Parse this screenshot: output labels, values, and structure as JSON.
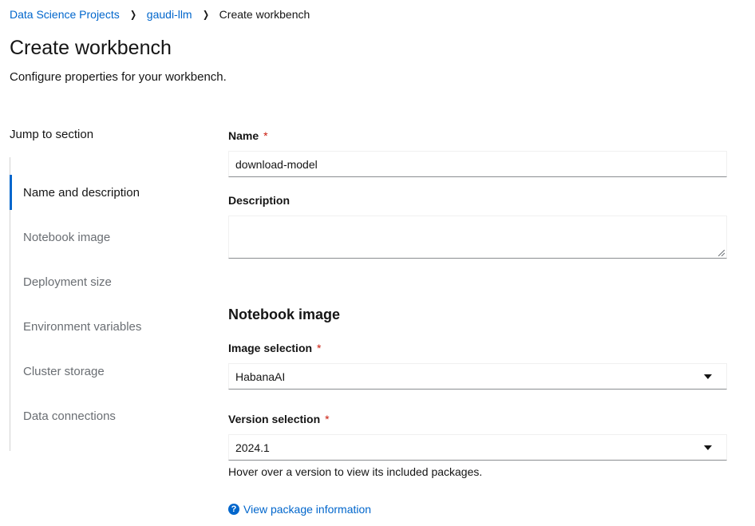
{
  "breadcrumb": {
    "items": [
      "Data Science Projects",
      "gaudi-llm"
    ],
    "current": "Create workbench"
  },
  "page": {
    "title": "Create workbench",
    "description": "Configure properties for your workbench."
  },
  "jump": {
    "title": "Jump to section",
    "items": [
      "Name and description",
      "Notebook image",
      "Deployment size",
      "Environment variables",
      "Cluster storage",
      "Data connections"
    ],
    "active": "Name and description"
  },
  "form": {
    "name_label": "Name",
    "name_value": "download-model",
    "description_label": "Description",
    "description_value": "",
    "notebook_section": "Notebook image",
    "image_label": "Image selection",
    "image_value": "HabanaAI",
    "version_label": "Version selection",
    "version_value": "2024.1",
    "version_helper": "Hover over a version to view its included packages.",
    "package_link": "View package information",
    "required_mark": "*"
  },
  "icons": {
    "breadcrumb_separator": "chevron-right-icon",
    "select_caret": "caret-down-icon",
    "help": "question-circle-icon"
  },
  "colors": {
    "link": "#0066cc",
    "required": "#c9190b",
    "nav_active": "#0066cc",
    "nav_inactive": "#6a6e73"
  }
}
